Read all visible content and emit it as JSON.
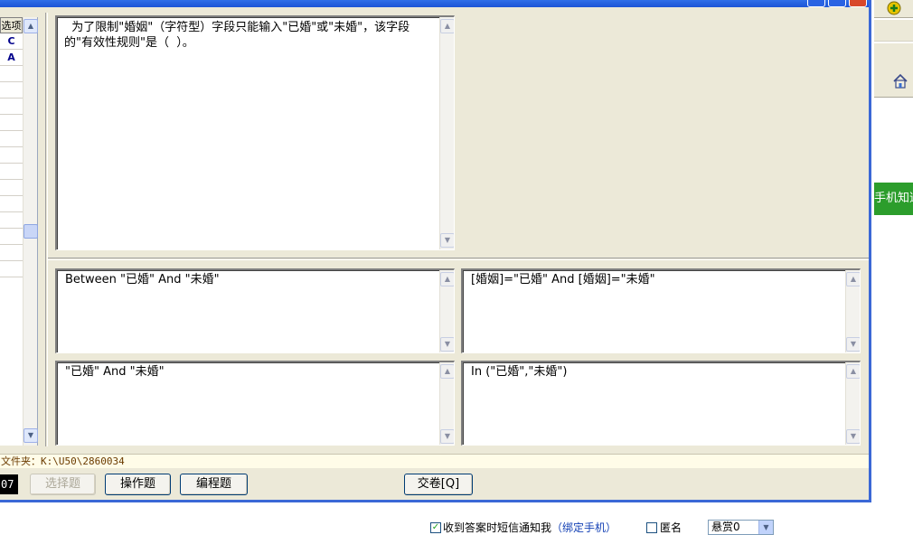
{
  "question": {
    "text": "  为了限制\"婚姻\"（字符型）字段只能输入\"已婚\"或\"未婚\"，该字段的\"有效性规则\"是（  ）。"
  },
  "options": [
    {
      "text": "Between \"已婚\" And \"未婚\""
    },
    {
      "text": "[婚姻]=\"已婚\" And [婚姻]=\"未婚\""
    },
    {
      "text": "\"已婚\" And \"未婚\""
    },
    {
      "text": "In (\"已婚\",\"未婚\")"
    }
  ],
  "answer_strip": {
    "header": "选项",
    "answers": [
      "C",
      "A"
    ]
  },
  "status": {
    "folder": "文件夹：K:\\U50\\2860034"
  },
  "toolbar": {
    "timer": "07",
    "choice_label": "选择题",
    "operation_label": "操作题",
    "programming_label": "编程题",
    "submit_label": "交卷[Q]"
  },
  "browser": {
    "banner_text": "手机知道"
  },
  "bottom_bar": {
    "sms_notify_label": "收到答案时短信通知我",
    "bind_phone_label": "（绑定手机）",
    "anonymous_label": "匿名",
    "reward_value": "悬赏0"
  },
  "colors": {
    "window_bg": "#ece9d8",
    "titlebar": "#1c54d6",
    "green_banner": "#2c9d2c",
    "status_bg": "#fffce8"
  }
}
